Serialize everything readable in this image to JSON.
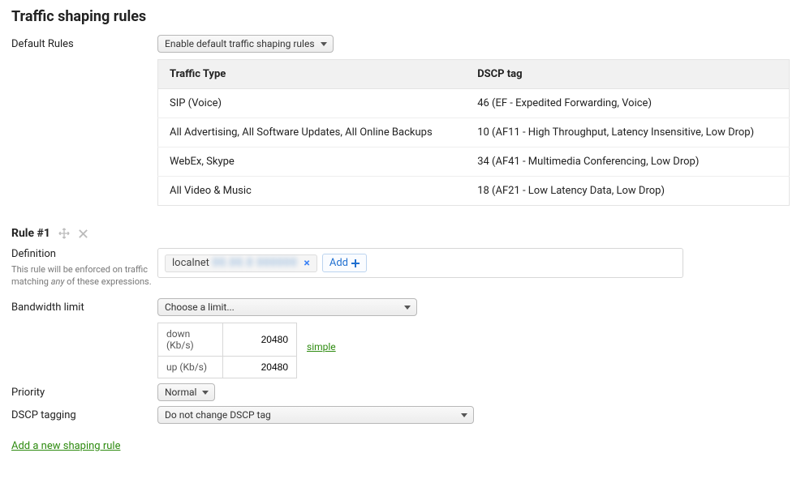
{
  "title": "Traffic shaping rules",
  "defaultRules": {
    "label": "Default Rules",
    "selectValue": "Enable default traffic shaping rules",
    "headers": {
      "trafficType": "Traffic Type",
      "dscpTag": "DSCP tag"
    },
    "rows": [
      {
        "traffic": "SIP (Voice)",
        "dscp": "46 (EF - Expedited Forwarding, Voice)"
      },
      {
        "traffic": "All Advertising, All Software Updates, All Online Backups",
        "dscp": "10 (AF11 - High Throughput, Latency Insensitive, Low Drop)"
      },
      {
        "traffic": "WebEx, Skype",
        "dscp": "34 (AF41 - Multimedia Conferencing, Low Drop)"
      },
      {
        "traffic": "All Video & Music",
        "dscp": "18 (AF21 - Low Latency Data, Low Drop)"
      }
    ]
  },
  "rule1": {
    "title": "Rule #1",
    "definition": {
      "label": "Definition",
      "help_pre": "This rule will be enforced on traffic matching ",
      "help_em": "any",
      "help_post": " of these expressions.",
      "tag_text": "localnet",
      "tag_blur": "00.00.0  000000",
      "add_label": "Add"
    },
    "bandwidth": {
      "label": "Bandwidth limit",
      "selectValue": "Choose a limit...",
      "down_label": "down (Kb/s)",
      "up_label": "up (Kb/s)",
      "down_value": "20480",
      "up_value": "20480",
      "simple": "simple"
    },
    "priority": {
      "label": "Priority",
      "value": "Normal"
    },
    "dscp": {
      "label": "DSCP tagging",
      "value": "Do not change DSCP tag"
    }
  },
  "addRule": "Add a new shaping rule"
}
